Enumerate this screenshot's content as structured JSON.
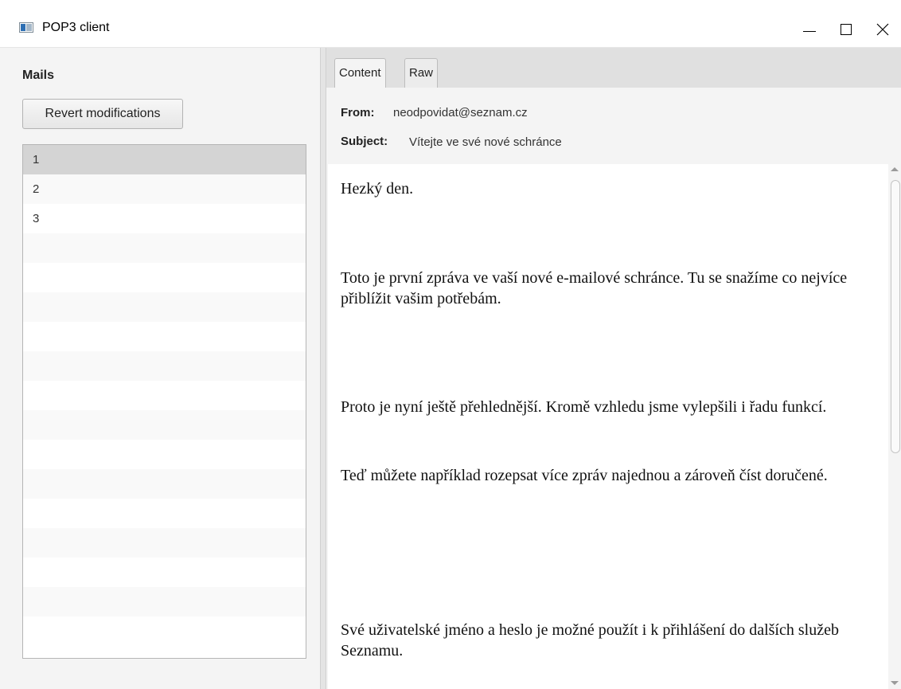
{
  "window": {
    "title": "POP3 client"
  },
  "left": {
    "heading": "Mails",
    "revert_label": "Revert modifications",
    "mails": [
      "1",
      "2",
      "3"
    ]
  },
  "tabs": [
    {
      "label": "Content",
      "active": true
    },
    {
      "label": "Raw",
      "active": false
    }
  ],
  "message": {
    "from_label": "From:",
    "from_value": "neodpovidat@seznam.cz",
    "subject_label": "Subject:",
    "subject_value": "Vítejte ve své nové schránce",
    "paragraphs": [
      "Hezký den.",
      "Toto je první zpráva ve vaší nové e-mailové schránce. Tu se snažíme co nejvíce přiblížit vašim potřebám.",
      "Proto je nyní ještě přehlednější. Kromě vzhledu jsme vylepšili i řadu funkcí.",
      "Teď můžete například rozepsat více zpráv najednou a zároveň číst doručené.",
      "Své uživatelské jméno a heslo je možné použít i k přihlášení do dalších služeb Seznamu."
    ]
  },
  "icons": {
    "app": "app-window-icon",
    "minimize": "minimize-icon",
    "maximize": "maximize-icon",
    "close": "close-icon"
  },
  "colors": {
    "selected_row": "#d4d4d4",
    "pane_bg": "#f4f4f4",
    "tabbar_bg": "#e0e0e0"
  }
}
